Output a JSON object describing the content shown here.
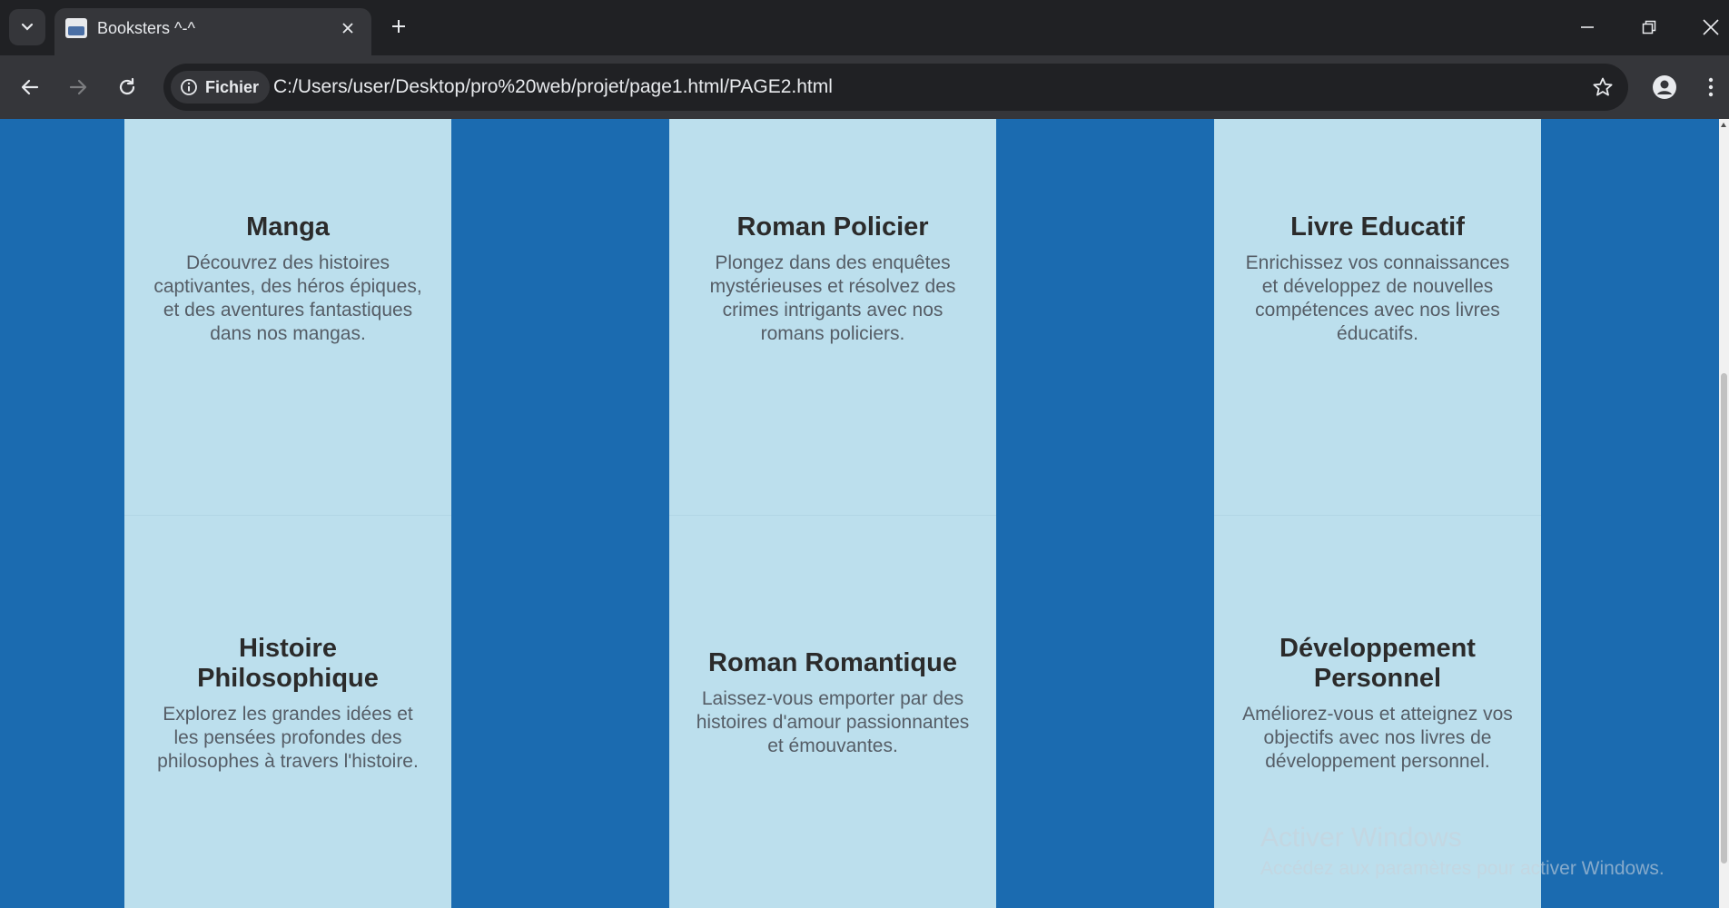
{
  "browser": {
    "tab": {
      "title": "Booksters ^-^"
    },
    "site_chip": "Fichier",
    "url": "C:/Users/user/Desktop/pro%20web/projet/page1.html/PAGE2.html",
    "icons": {
      "tab_search": "chevron-down-icon",
      "favicon": "favicon-icon",
      "tab_close": "close-icon",
      "new_tab": "plus-icon",
      "minimize": "minimize-icon",
      "restore": "restore-icon",
      "close_window": "close-icon",
      "back": "arrow-left-icon",
      "forward": "arrow-right-icon",
      "reload": "reload-icon",
      "site_info": "info-icon",
      "bookmark": "star-icon",
      "profile": "profile-icon",
      "menu": "kebab-menu-icon"
    }
  },
  "colors": {
    "page_background": "#1b6bb0",
    "card_background": "#bcdfed",
    "title_color": "#2b2b2b",
    "text_color": "#555d66",
    "chrome_dark": "#202124",
    "chrome_mid": "#35363a"
  },
  "categories": [
    {
      "title": "Manga",
      "description": "Découvrez des histoires captivantes, des héros épiques, et des aventures fantastiques dans nos mangas."
    },
    {
      "title": "Roman Policier",
      "description": "Plongez dans des enquêtes mystérieuses et résolvez des crimes intrigants avec nos romans policiers."
    },
    {
      "title": "Livre Educatif",
      "description": "Enrichissez vos connaissances et développez de nouvelles compétences avec nos livres éducatifs."
    },
    {
      "title": "Histoire Philosophique",
      "description": "Explorez les grandes idées et les pensées profondes des philosophes à travers l'histoire."
    },
    {
      "title": "Roman Romantique",
      "description": "Laissez-vous emporter par des histoires d'amour passionnantes et émouvantes."
    },
    {
      "title": "Développement Personnel",
      "description": "Améliorez-vous et atteignez vos objectifs avec nos livres de développement personnel."
    }
  ],
  "watermark": {
    "title": "Activer Windows",
    "subtitle": "Accédez aux paramètres pour activer Windows."
  }
}
